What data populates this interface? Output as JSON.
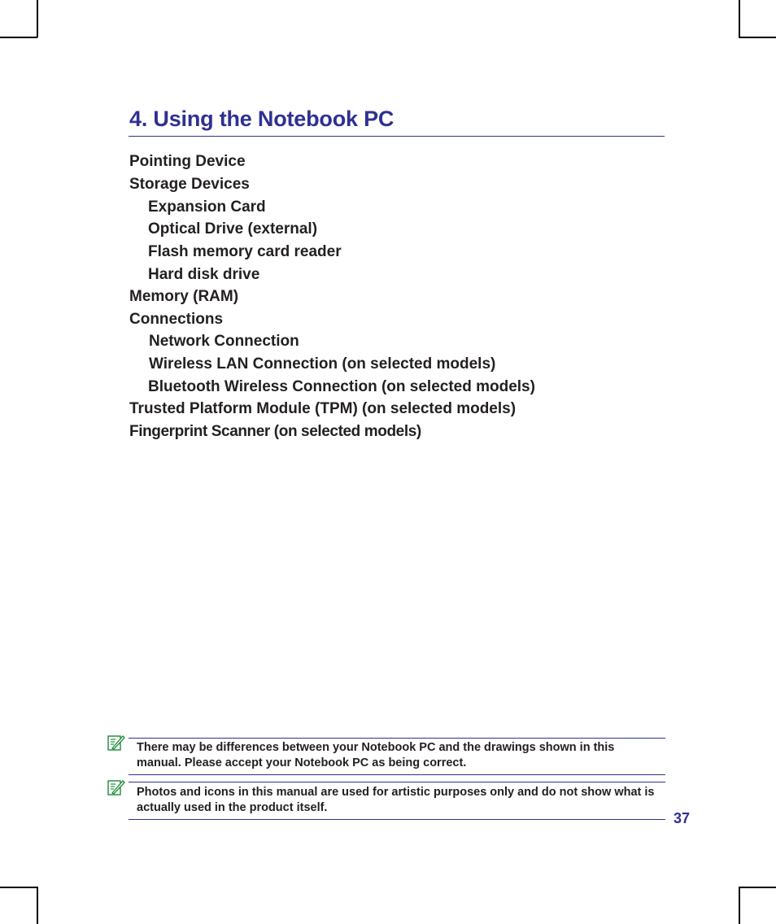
{
  "page": {
    "title": "4. Using the Notebook PC",
    "page_number": "37",
    "accent_color": "#2e3192"
  },
  "toc": {
    "items": [
      {
        "label": "Pointing Device",
        "level": 1
      },
      {
        "label": "Storage Devices",
        "level": 1
      },
      {
        "label": "Expansion Card",
        "level": 2
      },
      {
        "label": "Optical Drive (external)",
        "level": 2
      },
      {
        "label": "Flash memory card reader",
        "level": 2
      },
      {
        "label": "Hard disk drive",
        "level": 2
      },
      {
        "label": "Memory (RAM)",
        "level": 1
      },
      {
        "label": "Connections",
        "level": 1
      },
      {
        "label": "Network Connection",
        "level": 2
      },
      {
        "label": "Wireless LAN Connection (on selected models)",
        "level": 2
      },
      {
        "label": "Bluetooth Wireless Connection (on selected models)",
        "level": 2
      },
      {
        "label": "Trusted Platform Module (TPM) (on selected models)",
        "level": 1
      },
      {
        "label": "Fingerprint Scanner (on selected models)",
        "level": 1
      }
    ]
  },
  "notes": [
    {
      "icon": "note-pencil-icon",
      "text": "There may be differences between your Notebook PC and the drawings shown in this manual. Please accept your Notebook PC as being correct."
    },
    {
      "icon": "note-pencil-icon",
      "text": "Photos and icons in this manual are used for artistic purposes only and do not show what is actually used in the product itself."
    }
  ]
}
